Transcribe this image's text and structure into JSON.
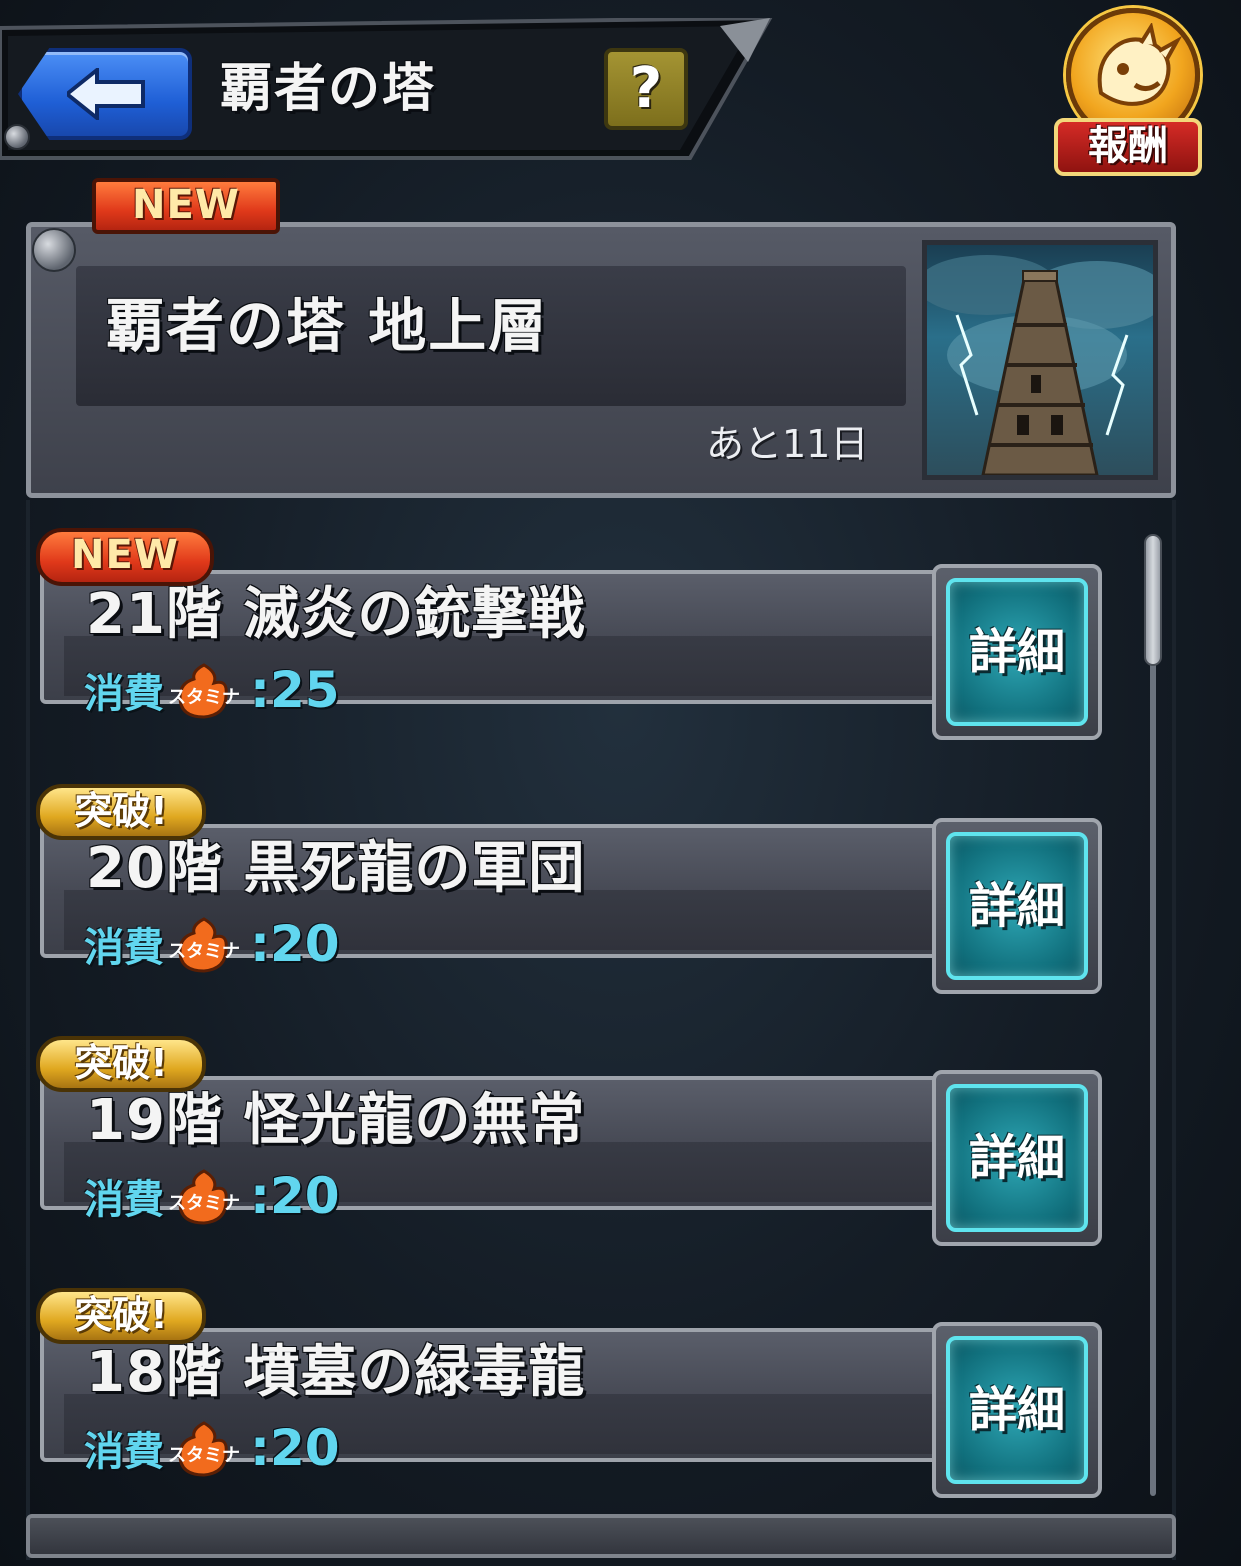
{
  "header": {
    "title": "覇者の塔",
    "help_label": "?",
    "reward_label": "報酬"
  },
  "event": {
    "new_label": "NEW",
    "title": "覇者の塔 地上層",
    "remaining": "あと11日"
  },
  "stages": [
    {
      "tag": "NEW",
      "tag_type": "new",
      "name": "21階 滅炎の銃撃戦",
      "cost_label": "消費",
      "stamina_label": "スタミナ",
      "cost_value": ":25",
      "detail_label": "詳細"
    },
    {
      "tag": "突破!",
      "tag_type": "break",
      "name": "20階 黒死龍の軍団",
      "cost_label": "消費",
      "stamina_label": "スタミナ",
      "cost_value": ":20",
      "detail_label": "詳細"
    },
    {
      "tag": "突破!",
      "tag_type": "break",
      "name": "19階 怪光龍の無常",
      "cost_label": "消費",
      "stamina_label": "スタミナ",
      "cost_value": ":20",
      "detail_label": "詳細"
    },
    {
      "tag": "突破!",
      "tag_type": "break",
      "name": "18階 墳墓の緑毒龍",
      "cost_label": "消費",
      "stamina_label": "スタミナ",
      "cost_value": ":20",
      "detail_label": "詳細"
    }
  ],
  "colors": {
    "accent_cyan": "#61d6ef",
    "new_tag": "#e0391a",
    "break_tag": "#e0a820",
    "back_button": "#1f5fd6"
  }
}
